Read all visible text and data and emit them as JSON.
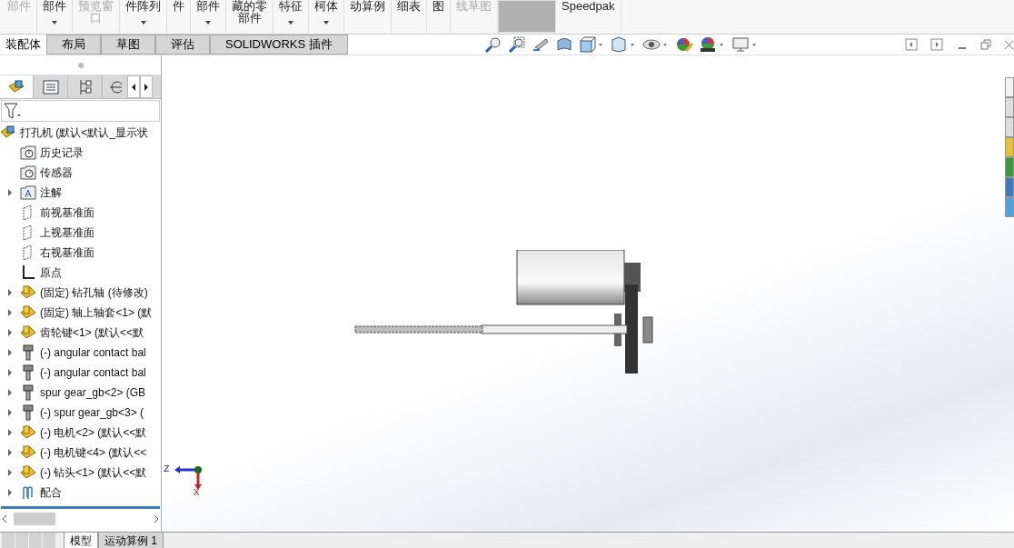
{
  "ribbon": [
    {
      "lines": [
        "部件"
      ],
      "disabled": true,
      "caret": false,
      "selected": false
    },
    {
      "lines": [
        "部件"
      ],
      "disabled": false,
      "caret": true,
      "selected": false
    },
    {
      "lines": [
        "预览窗",
        "口"
      ],
      "disabled": true,
      "caret": false,
      "selected": false
    },
    {
      "lines": [
        "件阵列"
      ],
      "disabled": false,
      "caret": true,
      "selected": false
    },
    {
      "lines": [
        "件"
      ],
      "disabled": false,
      "caret": false,
      "selected": false
    },
    {
      "lines": [
        "部件"
      ],
      "disabled": false,
      "caret": true,
      "selected": false
    },
    {
      "lines": [
        "藏的零",
        "部件"
      ],
      "disabled": false,
      "caret": false,
      "selected": false
    },
    {
      "lines": [
        "特征"
      ],
      "disabled": false,
      "caret": true,
      "selected": false
    },
    {
      "lines": [
        "柯体"
      ],
      "disabled": false,
      "caret": true,
      "selected": false
    },
    {
      "lines": [
        "动算例"
      ],
      "disabled": false,
      "caret": false,
      "selected": false
    },
    {
      "lines": [
        "细表"
      ],
      "disabled": false,
      "caret": false,
      "selected": false
    },
    {
      "lines": [
        "图"
      ],
      "disabled": false,
      "caret": false,
      "selected": false
    },
    {
      "lines": [
        "线草图"
      ],
      "disabled": true,
      "caret": false,
      "selected": false
    },
    {
      "disabled": false,
      "caret": false,
      "selected": true
    },
    {
      "lines": [
        "Speedpak"
      ],
      "disabled": false,
      "caret": false,
      "selected": false
    }
  ],
  "tabs": [
    {
      "label": "装配体",
      "selected": true
    },
    {
      "label": "布局",
      "selected": false
    },
    {
      "label": "草图",
      "selected": false
    },
    {
      "label": "评估",
      "selected": false
    },
    {
      "label": "SOLIDWORKS 插件",
      "selected": false
    }
  ],
  "tree": [
    {
      "kind": "assembly",
      "label": "打孔机  (默认<默认_显示状",
      "expandable": false
    },
    {
      "kind": "history",
      "label": "历史记录",
      "expandable": false
    },
    {
      "kind": "sensor",
      "label": "传感器",
      "expandable": false
    },
    {
      "kind": "annotation",
      "label": "注解",
      "expandable": true
    },
    {
      "kind": "plane",
      "label": "前视基准面",
      "expandable": false
    },
    {
      "kind": "plane",
      "label": "上视基准面",
      "expandable": false
    },
    {
      "kind": "plane",
      "label": "右视基准面",
      "expandable": false
    },
    {
      "kind": "origin",
      "label": "原点",
      "expandable": false
    },
    {
      "kind": "part",
      "label": "(固定) 钻孔轴  (待修改)",
      "expandable": true
    },
    {
      "kind": "part",
      "label": "(固定) 轴上轴套<1> (默",
      "expandable": true
    },
    {
      "kind": "part",
      "label": "齿轮键<1> (默认<<默",
      "expandable": true
    },
    {
      "kind": "toolbox",
      "label": "(-) angular contact bal",
      "expandable": true
    },
    {
      "kind": "toolbox",
      "label": "(-) angular contact bal",
      "expandable": true
    },
    {
      "kind": "toolbox",
      "label": "spur gear_gb<2> (GB",
      "expandable": true
    },
    {
      "kind": "toolbox",
      "label": "(-) spur gear_gb<3> (",
      "expandable": true
    },
    {
      "kind": "part",
      "label": "(-) 电机<2> (默认<<默",
      "expandable": true
    },
    {
      "kind": "part",
      "label": "(-) 电机键<4> (默认<<",
      "expandable": true
    },
    {
      "kind": "part",
      "label": "(-) 钻头<1> (默认<<默",
      "expandable": true
    },
    {
      "kind": "mates",
      "label": "配合",
      "expandable": true
    }
  ],
  "triad": {
    "axis_1": "Z",
    "axis_2": "X"
  },
  "bottom_tabs": [
    {
      "label": "模型",
      "selected": true
    },
    {
      "label": "运动算例 1",
      "selected": false
    }
  ]
}
